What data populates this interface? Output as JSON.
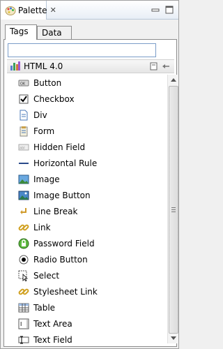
{
  "view": {
    "title": "Palette",
    "close_glyph": "✕",
    "icon": "palette-icon"
  },
  "tabs": [
    {
      "label": "Tags",
      "active": true
    },
    {
      "label": "Data",
      "active": false
    }
  ],
  "search": {
    "value": "",
    "placeholder": ""
  },
  "drawer": {
    "title": "HTML 4.0",
    "icon": "html-drawer-icon"
  },
  "items": [
    {
      "label": "Button",
      "icon": "button-icon"
    },
    {
      "label": "Checkbox",
      "icon": "checkbox-icon"
    },
    {
      "label": "Div",
      "icon": "div-icon"
    },
    {
      "label": "Form",
      "icon": "form-icon"
    },
    {
      "label": "Hidden Field",
      "icon": "hidden-field-icon"
    },
    {
      "label": "Horizontal Rule",
      "icon": "horizontal-rule-icon"
    },
    {
      "label": "Image",
      "icon": "image-icon"
    },
    {
      "label": "Image Button",
      "icon": "image-button-icon"
    },
    {
      "label": "Line Break",
      "icon": "line-break-icon"
    },
    {
      "label": "Link",
      "icon": "link-icon"
    },
    {
      "label": "Password Field",
      "icon": "password-field-icon"
    },
    {
      "label": "Radio Button",
      "icon": "radio-button-icon"
    },
    {
      "label": "Select",
      "icon": "select-icon"
    },
    {
      "label": "Stylesheet Link",
      "icon": "stylesheet-link-icon"
    },
    {
      "label": "Table",
      "icon": "table-icon"
    },
    {
      "label": "Text Area",
      "icon": "text-area-icon"
    },
    {
      "label": "Text Field",
      "icon": "text-field-icon"
    }
  ],
  "colors": {
    "accent": "#7a9cc8",
    "tabbar": "#e8eef6"
  }
}
